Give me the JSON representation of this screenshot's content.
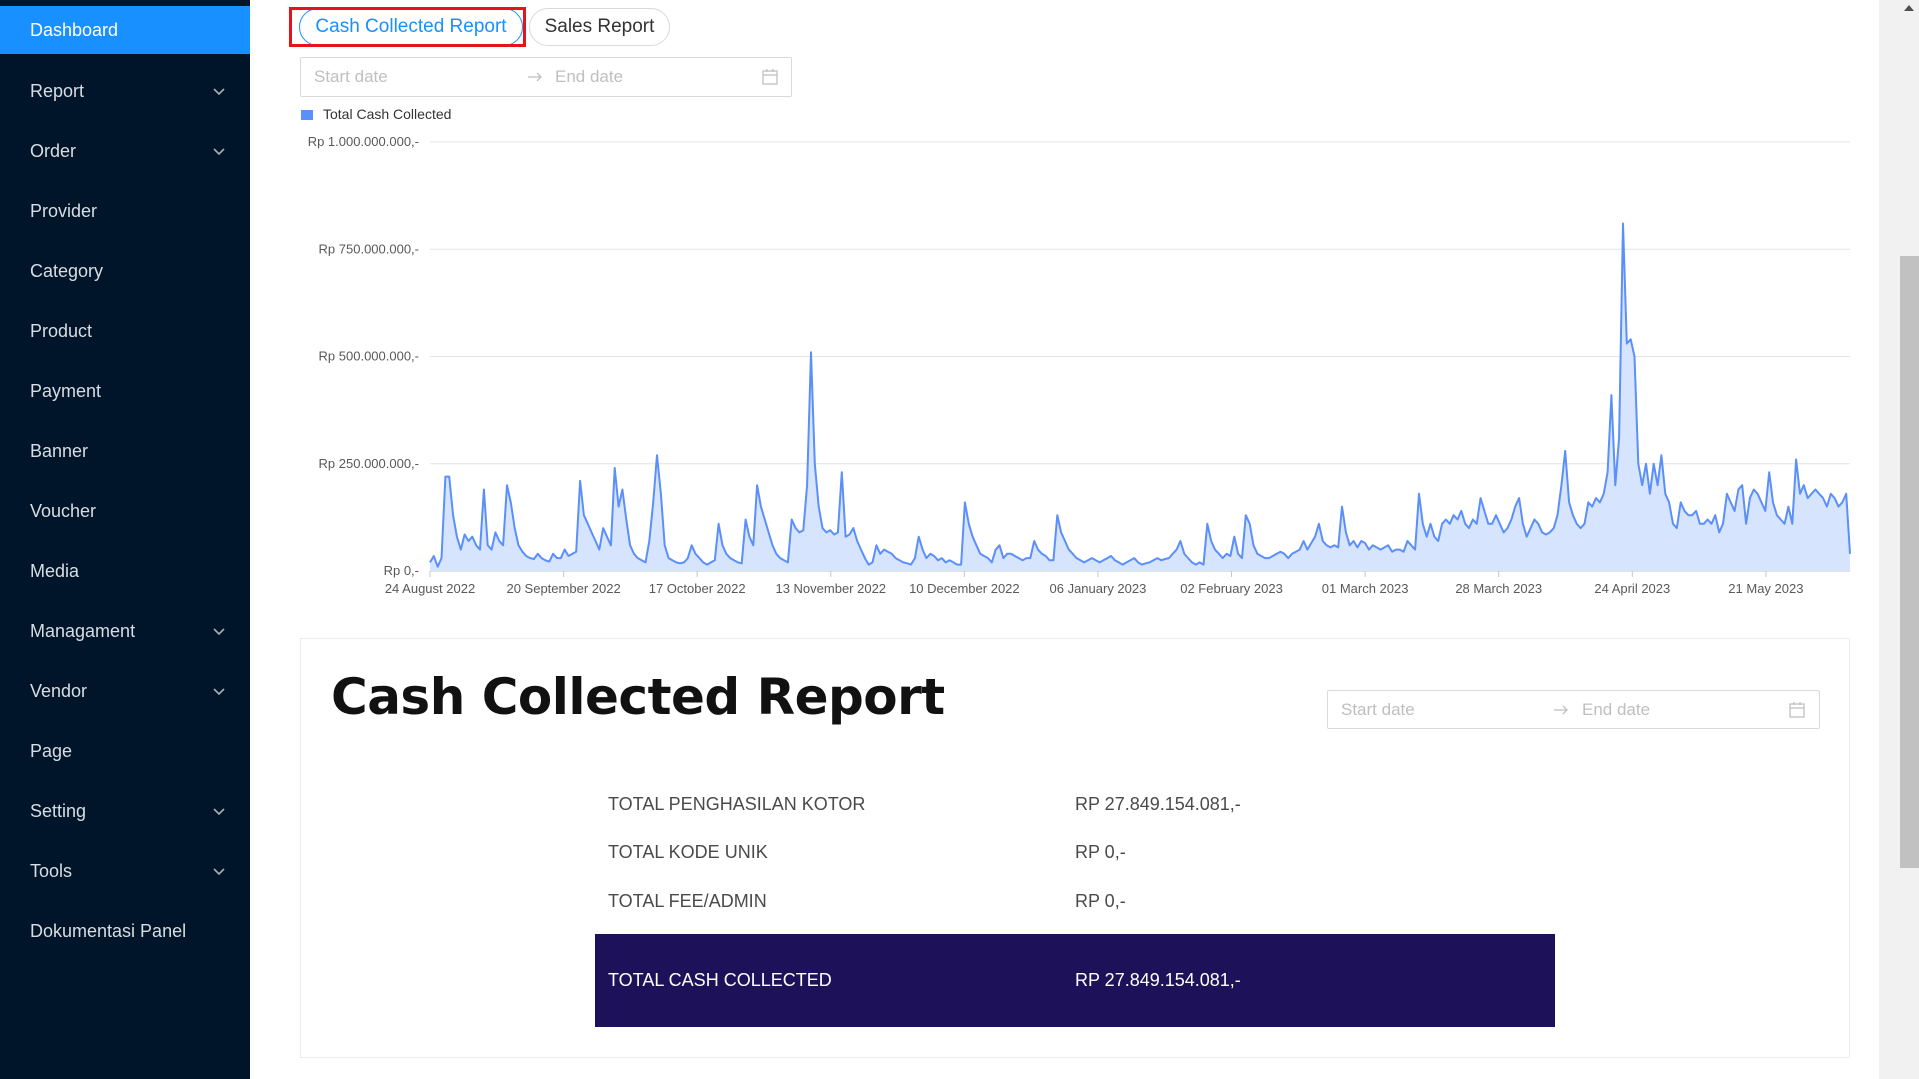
{
  "sidebar": {
    "items": [
      {
        "label": "Dashboard",
        "active": true,
        "expandable": false
      },
      {
        "label": "Report",
        "active": false,
        "expandable": true
      },
      {
        "label": "Order",
        "active": false,
        "expandable": true
      },
      {
        "label": "Provider",
        "active": false,
        "expandable": false
      },
      {
        "label": "Category",
        "active": false,
        "expandable": false
      },
      {
        "label": "Product",
        "active": false,
        "expandable": false
      },
      {
        "label": "Payment",
        "active": false,
        "expandable": false
      },
      {
        "label": "Banner",
        "active": false,
        "expandable": false
      },
      {
        "label": "Voucher",
        "active": false,
        "expandable": false
      },
      {
        "label": "Media",
        "active": false,
        "expandable": false
      },
      {
        "label": "Managament",
        "active": false,
        "expandable": true
      },
      {
        "label": "Vendor",
        "active": false,
        "expandable": true
      },
      {
        "label": "Page",
        "active": false,
        "expandable": false
      },
      {
        "label": "Setting",
        "active": false,
        "expandable": true
      },
      {
        "label": "Tools",
        "active": false,
        "expandable": true
      },
      {
        "label": "Dokumentasi Panel",
        "active": false,
        "expandable": false
      }
    ]
  },
  "tabs": [
    {
      "label": "Cash Collected Report",
      "active": true
    },
    {
      "label": "Sales Report",
      "active": false
    }
  ],
  "date_filter": {
    "start_placeholder": "Start date",
    "end_placeholder": "End date"
  },
  "chart_data": {
    "type": "area",
    "legend": [
      "Total Cash Collected"
    ],
    "legend_position": "top-left",
    "grid": true,
    "ylim": [
      0,
      1000000000
    ],
    "y_tick_labels": [
      "Rp 0,-",
      "Rp 250.000.000,-",
      "Rp 500.000.000,-",
      "Rp 750.000.000,-",
      "Rp 1.000.000.000,-"
    ],
    "x_tick_labels": [
      "24 August 2022",
      "20 September 2022",
      "17 October 2022",
      "13 November 2022",
      "10 December 2022",
      "06 January 2023",
      "02 February 2023",
      "01 March 2023",
      "28 March 2023",
      "24 April 2023",
      "21 May 2023"
    ],
    "x_start": "2022-08-24",
    "x_end": "2023-06-07",
    "series": [
      {
        "name": "Total Cash Collected",
        "color": "#5b8ff9",
        "fill": "#d6e4fd",
        "values": [
          20000000,
          35000000,
          10000000,
          30000000,
          220000000,
          220000000,
          130000000,
          80000000,
          50000000,
          85000000,
          70000000,
          80000000,
          60000000,
          50000000,
          190000000,
          60000000,
          50000000,
          90000000,
          70000000,
          60000000,
          200000000,
          160000000,
          100000000,
          60000000,
          45000000,
          35000000,
          30000000,
          28000000,
          40000000,
          30000000,
          25000000,
          22000000,
          40000000,
          30000000,
          30000000,
          50000000,
          35000000,
          40000000,
          45000000,
          210000000,
          130000000,
          110000000,
          90000000,
          70000000,
          50000000,
          100000000,
          80000000,
          60000000,
          240000000,
          150000000,
          190000000,
          120000000,
          60000000,
          40000000,
          30000000,
          25000000,
          20000000,
          70000000,
          160000000,
          270000000,
          180000000,
          60000000,
          30000000,
          25000000,
          20000000,
          18000000,
          20000000,
          30000000,
          60000000,
          40000000,
          30000000,
          20000000,
          15000000,
          20000000,
          25000000,
          110000000,
          60000000,
          40000000,
          30000000,
          25000000,
          20000000,
          18000000,
          120000000,
          80000000,
          60000000,
          200000000,
          150000000,
          120000000,
          90000000,
          60000000,
          40000000,
          30000000,
          25000000,
          20000000,
          120000000,
          100000000,
          90000000,
          95000000,
          200000000,
          510000000,
          250000000,
          150000000,
          100000000,
          90000000,
          95000000,
          85000000,
          90000000,
          230000000,
          80000000,
          85000000,
          100000000,
          70000000,
          50000000,
          30000000,
          15000000,
          20000000,
          60000000,
          40000000,
          50000000,
          45000000,
          40000000,
          30000000,
          25000000,
          20000000,
          18000000,
          15000000,
          30000000,
          80000000,
          50000000,
          30000000,
          40000000,
          35000000,
          25000000,
          30000000,
          20000000,
          25000000,
          20000000,
          15000000,
          15000000,
          160000000,
          110000000,
          80000000,
          60000000,
          40000000,
          35000000,
          30000000,
          20000000,
          50000000,
          60000000,
          30000000,
          40000000,
          40000000,
          35000000,
          30000000,
          25000000,
          30000000,
          30000000,
          70000000,
          50000000,
          40000000,
          35000000,
          25000000,
          25000000,
          130000000,
          90000000,
          70000000,
          50000000,
          40000000,
          30000000,
          25000000,
          20000000,
          25000000,
          30000000,
          25000000,
          20000000,
          25000000,
          30000000,
          35000000,
          25000000,
          20000000,
          15000000,
          20000000,
          25000000,
          30000000,
          20000000,
          15000000,
          18000000,
          20000000,
          25000000,
          30000000,
          25000000,
          28000000,
          30000000,
          40000000,
          50000000,
          70000000,
          40000000,
          30000000,
          20000000,
          15000000,
          20000000,
          15000000,
          110000000,
          70000000,
          50000000,
          40000000,
          30000000,
          40000000,
          35000000,
          80000000,
          40000000,
          30000000,
          130000000,
          110000000,
          60000000,
          40000000,
          35000000,
          30000000,
          30000000,
          35000000,
          40000000,
          45000000,
          40000000,
          30000000,
          40000000,
          45000000,
          50000000,
          70000000,
          50000000,
          65000000,
          80000000,
          110000000,
          70000000,
          60000000,
          55000000,
          60000000,
          55000000,
          150000000,
          90000000,
          60000000,
          70000000,
          55000000,
          70000000,
          65000000,
          50000000,
          60000000,
          55000000,
          50000000,
          55000000,
          60000000,
          45000000,
          50000000,
          50000000,
          45000000,
          70000000,
          60000000,
          50000000,
          180000000,
          110000000,
          80000000,
          110000000,
          80000000,
          70000000,
          110000000,
          120000000,
          110000000,
          130000000,
          120000000,
          140000000,
          110000000,
          100000000,
          120000000,
          110000000,
          170000000,
          140000000,
          110000000,
          110000000,
          130000000,
          110000000,
          90000000,
          100000000,
          120000000,
          150000000,
          170000000,
          110000000,
          80000000,
          100000000,
          120000000,
          110000000,
          90000000,
          85000000,
          90000000,
          100000000,
          130000000,
          200000000,
          280000000,
          160000000,
          130000000,
          110000000,
          100000000,
          110000000,
          160000000,
          150000000,
          170000000,
          160000000,
          180000000,
          230000000,
          410000000,
          200000000,
          310000000,
          810000000,
          530000000,
          540000000,
          500000000,
          250000000,
          200000000,
          250000000,
          180000000,
          250000000,
          200000000,
          270000000,
          180000000,
          160000000,
          110000000,
          100000000,
          160000000,
          140000000,
          130000000,
          130000000,
          140000000,
          110000000,
          110000000,
          120000000,
          110000000,
          130000000,
          90000000,
          110000000,
          180000000,
          160000000,
          140000000,
          190000000,
          200000000,
          110000000,
          170000000,
          190000000,
          180000000,
          160000000,
          140000000,
          230000000,
          160000000,
          130000000,
          120000000,
          110000000,
          150000000,
          110000000,
          260000000,
          180000000,
          200000000,
          170000000,
          180000000,
          190000000,
          180000000,
          170000000,
          150000000,
          180000000,
          170000000,
          150000000,
          160000000,
          180000000,
          40000000
        ]
      }
    ]
  },
  "report": {
    "title": "Cash Collected Report",
    "rows": [
      {
        "label": "TOTAL PENGHASILAN KOTOR",
        "value": "RP 27.849.154.081,-"
      },
      {
        "label": "TOTAL KODE UNIK",
        "value": "RP 0,-"
      },
      {
        "label": "TOTAL FEE/ADMIN",
        "value": "RP 0,-"
      }
    ],
    "total": {
      "label": "TOTAL CASH COLLECTED",
      "value": "RP 27.849.154.081,-"
    }
  },
  "colors": {
    "sidebar_bg": "#001529",
    "sidebar_active": "#1890ff",
    "accent": "#1890ff",
    "highlight_outline": "#e8121c",
    "total_bar_bg": "#1d1259",
    "series_line": "#5b8ff9",
    "series_fill": "#d6e4fd"
  },
  "icons": {
    "nav_expand": "chevron-down-icon",
    "date_separator": "arrow-right-icon",
    "date_picker": "calendar-icon",
    "scroll_up": "triangle-up-icon"
  }
}
